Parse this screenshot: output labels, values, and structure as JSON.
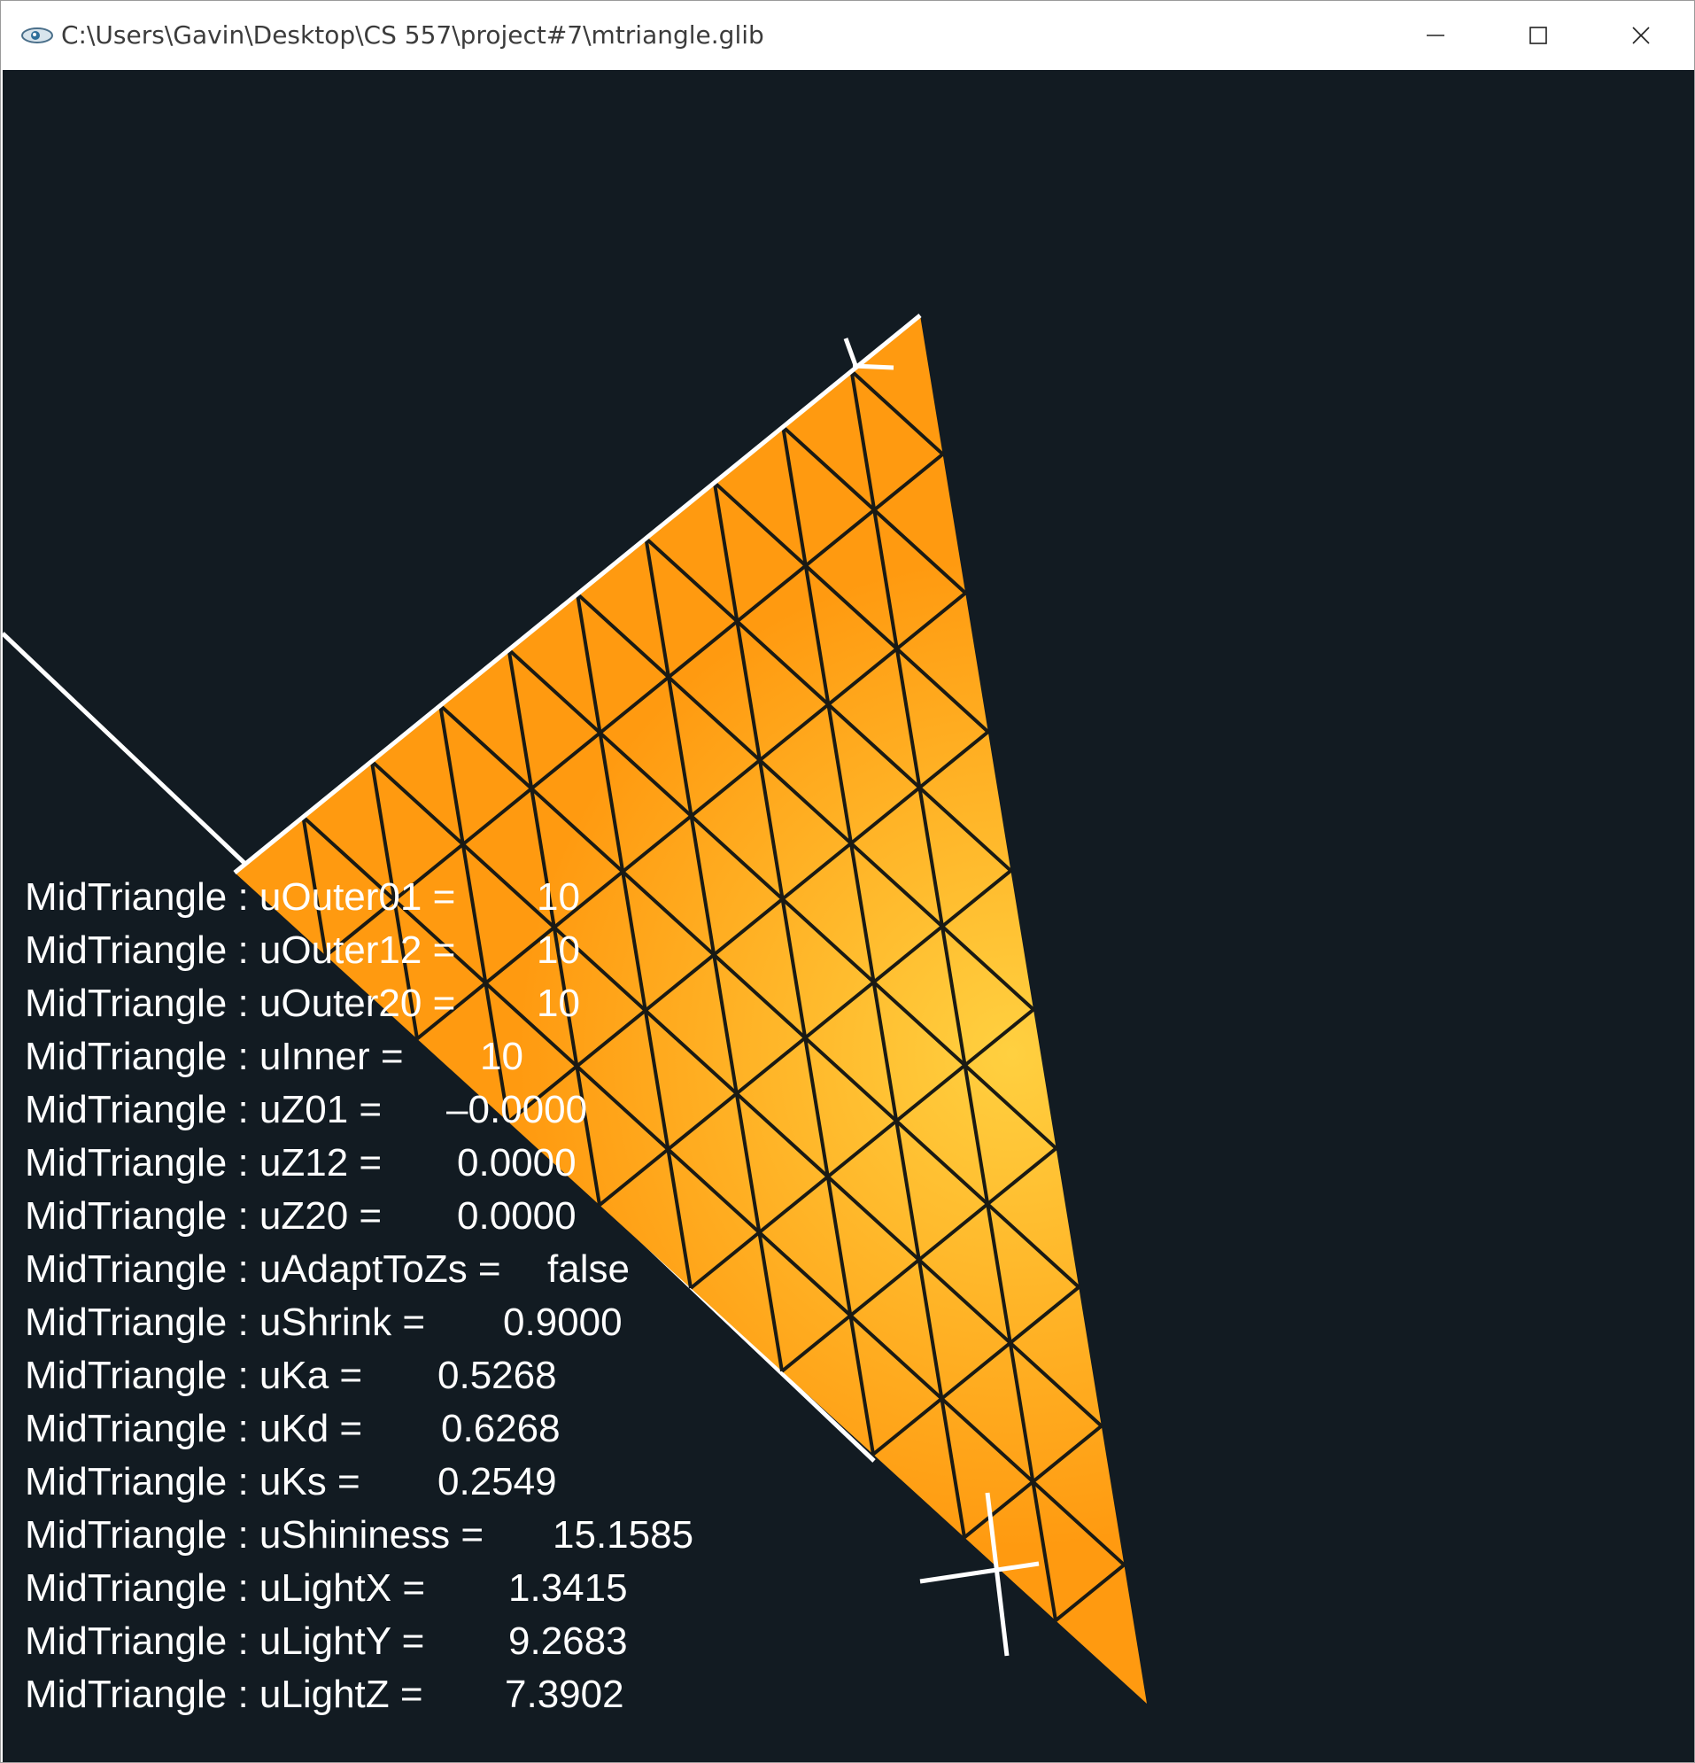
{
  "window": {
    "title": "C:\\Users\\Gavin\\Desktop\\CS 557\\project#7\\mtriangle.glib",
    "app_icon": "glman-eye-icon",
    "controls": {
      "minimize_icon": "minimize-icon",
      "maximize_icon": "maximize-icon",
      "close_icon": "close-icon"
    }
  },
  "scene": {
    "surface_color_light": "#ffd040",
    "surface_color_dark": "#ff9a10",
    "mesh_line_color": "#1a1a14",
    "background_color": "#121b22",
    "axis_color": "#ffffff"
  },
  "parameters": [
    {
      "name": "MidTriangle : uOuter01 =",
      "value": "10"
    },
    {
      "name": "MidTriangle : uOuter12 =",
      "value": "10"
    },
    {
      "name": "MidTriangle : uOuter20 =",
      "value": "10"
    },
    {
      "name": "MidTriangle : uInner =",
      "value": "10"
    },
    {
      "name": "MidTriangle : uZ01 =",
      "value": "–0.0000"
    },
    {
      "name": "MidTriangle : uZ12 =",
      "value": "0.0000"
    },
    {
      "name": "MidTriangle : uZ20 =",
      "value": "0.0000"
    },
    {
      "name": "MidTriangle : uAdaptToZs =",
      "value": "false"
    },
    {
      "name": "MidTriangle : uShrink =",
      "value": "0.9000"
    },
    {
      "name": "MidTriangle : uKa =",
      "value": "0.5268"
    },
    {
      "name": "MidTriangle : uKd =",
      "value": "0.6268"
    },
    {
      "name": "MidTriangle : uKs =",
      "value": "0.2549"
    },
    {
      "name": "MidTriangle : uShininess =",
      "value": "15.1585"
    },
    {
      "name": "MidTriangle : uLightX =",
      "value": "1.3415"
    },
    {
      "name": "MidTriangle : uLightY =",
      "value": "9.2683"
    },
    {
      "name": "MidTriangle : uLightZ =",
      "value": "7.3902"
    }
  ]
}
